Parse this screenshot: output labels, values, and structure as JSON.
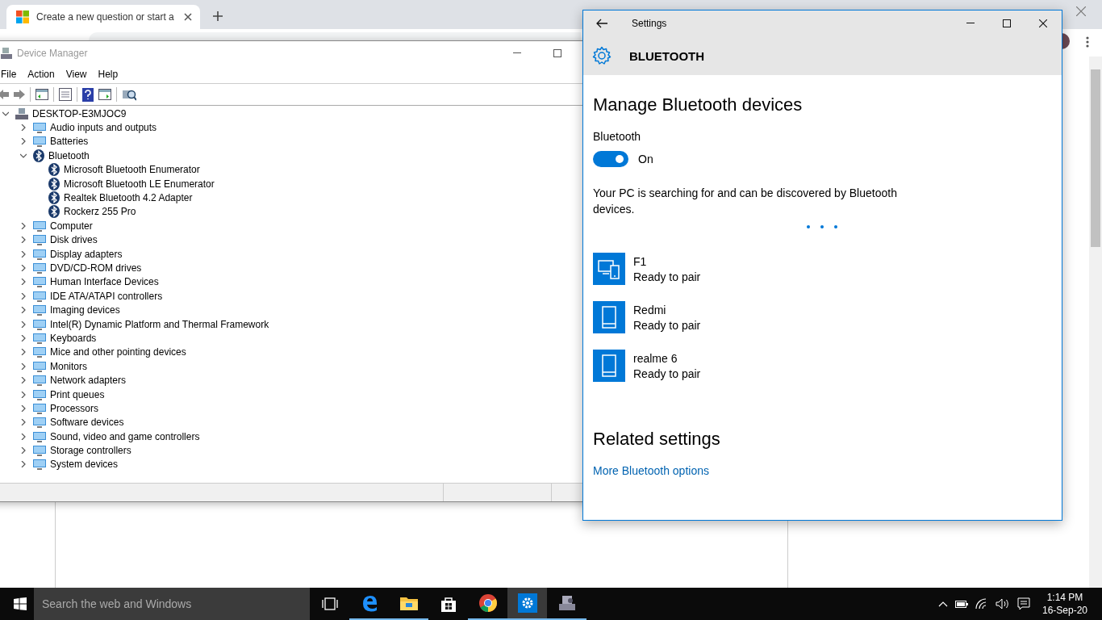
{
  "browser": {
    "tab_title": "Create a new question or start a"
  },
  "device_manager": {
    "title": "Device Manager",
    "menus": [
      "File",
      "Action",
      "View",
      "Help"
    ],
    "tree": {
      "label": "DESKTOP-E3MJOC9",
      "expanded": true,
      "children": [
        {
          "label": "Audio inputs and outputs",
          "expanded": false
        },
        {
          "label": "Batteries",
          "expanded": false
        },
        {
          "label": "Bluetooth",
          "expanded": true,
          "children": [
            {
              "label": "Microsoft Bluetooth Enumerator"
            },
            {
              "label": "Microsoft Bluetooth LE Enumerator"
            },
            {
              "label": "Realtek Bluetooth 4.2 Adapter"
            },
            {
              "label": "Rockerz 255 Pro"
            }
          ]
        },
        {
          "label": "Computer",
          "expanded": false
        },
        {
          "label": "Disk drives",
          "expanded": false
        },
        {
          "label": "Display adapters",
          "expanded": false
        },
        {
          "label": "DVD/CD-ROM drives",
          "expanded": false
        },
        {
          "label": "Human Interface Devices",
          "expanded": false
        },
        {
          "label": "IDE ATA/ATAPI controllers",
          "expanded": false
        },
        {
          "label": "Imaging devices",
          "expanded": false
        },
        {
          "label": "Intel(R) Dynamic Platform and Thermal Framework",
          "expanded": false
        },
        {
          "label": "Keyboards",
          "expanded": false
        },
        {
          "label": "Mice and other pointing devices",
          "expanded": false
        },
        {
          "label": "Monitors",
          "expanded": false
        },
        {
          "label": "Network adapters",
          "expanded": false
        },
        {
          "label": "Print queues",
          "expanded": false
        },
        {
          "label": "Processors",
          "expanded": false
        },
        {
          "label": "Software devices",
          "expanded": false
        },
        {
          "label": "Sound, video and game controllers",
          "expanded": false
        },
        {
          "label": "Storage controllers",
          "expanded": false
        },
        {
          "label": "System devices",
          "expanded": false
        }
      ]
    }
  },
  "settings": {
    "title": "Settings",
    "header": "BLUETOOTH",
    "heading": "Manage Bluetooth devices",
    "toggle_label": "Bluetooth",
    "toggle_on": true,
    "toggle_state": "On",
    "description": "Your PC is searching for and can be discovered by Bluetooth devices.",
    "devices": [
      {
        "kind": "computer",
        "name": "F1",
        "status": "Ready to pair"
      },
      {
        "kind": "phone",
        "name": "Redmi",
        "status": "Ready to pair"
      },
      {
        "kind": "phone",
        "name": "realme 6",
        "status": "Ready to pair"
      }
    ],
    "related_heading": "Related settings",
    "link": "More Bluetooth options"
  },
  "taskbar": {
    "search_placeholder": "Search the web and Windows",
    "apps": [
      {
        "kind": "taskview",
        "running": false,
        "selected": false
      },
      {
        "kind": "edge",
        "running": true,
        "selected": false
      },
      {
        "kind": "explorer",
        "running": true,
        "selected": false
      },
      {
        "kind": "store",
        "running": false,
        "selected": false
      },
      {
        "kind": "chrome",
        "running": true,
        "selected": false
      },
      {
        "kind": "settings",
        "running": true,
        "selected": true
      },
      {
        "kind": "devmgr",
        "running": true,
        "selected": false
      }
    ],
    "time": "1:14 PM",
    "date": "16-Sep-20"
  }
}
